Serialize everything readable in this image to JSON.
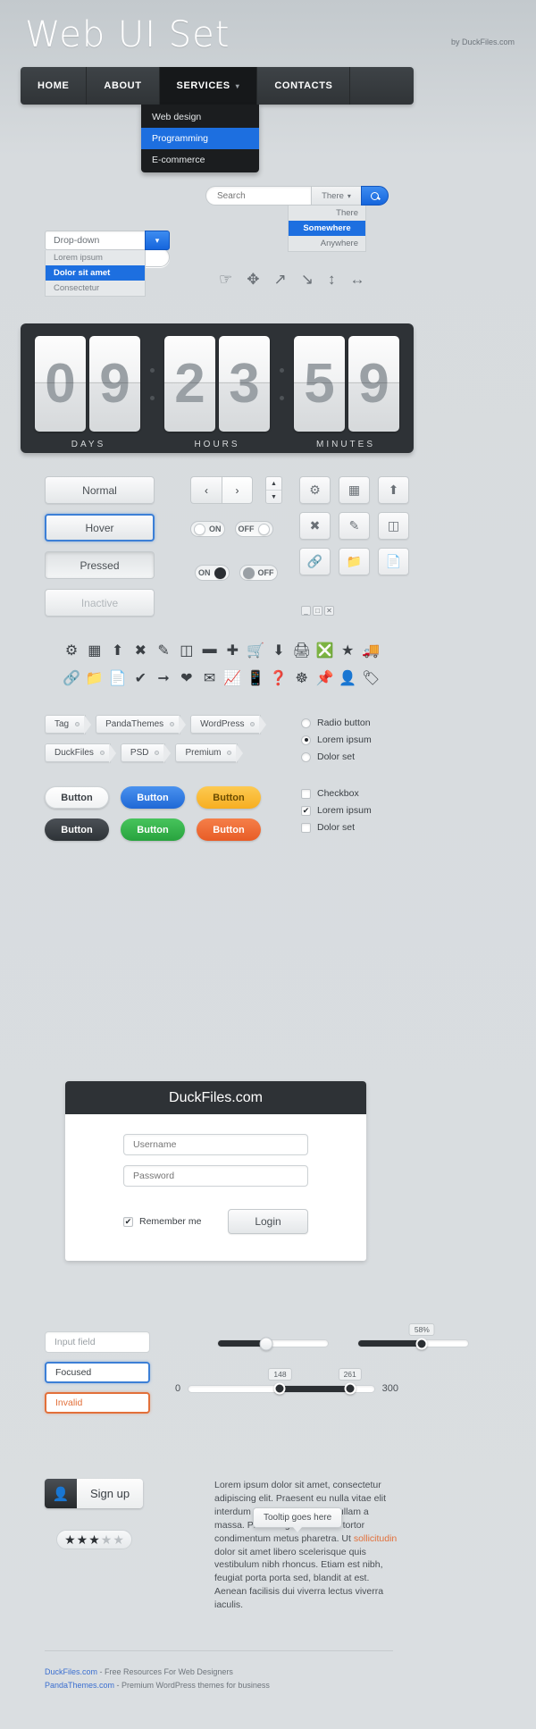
{
  "header": {
    "title": "Web UI Set",
    "byline": "by DuckFiles.com"
  },
  "nav": {
    "items": [
      {
        "label": "HOME",
        "active": false
      },
      {
        "label": "ABOUT",
        "active": false
      },
      {
        "label": "SERVICES",
        "active": true,
        "caret": "chevron-down"
      },
      {
        "label": "CONTACTS",
        "active": false
      }
    ],
    "submenu": [
      {
        "label": "Web design",
        "selected": false
      },
      {
        "label": "Programming",
        "selected": true
      },
      {
        "label": "E-commerce",
        "selected": false
      }
    ]
  },
  "search": {
    "rounded_placeholder": "Search",
    "combo_placeholder": "Search",
    "scope_value": "There",
    "scope_options": [
      {
        "label": "There",
        "selected": false
      },
      {
        "label": "Somewhere",
        "selected": true
      },
      {
        "label": "Anywhere",
        "selected": false
      }
    ]
  },
  "dropdown": {
    "value": "Drop-down",
    "options": [
      {
        "label": "Lorem ipsum",
        "selected": false
      },
      {
        "label": "Dolor sit amet",
        "selected": true
      },
      {
        "label": "Consectetur",
        "selected": false
      }
    ]
  },
  "cursors": [
    "pointer-hand-icon",
    "move-icon",
    "resize-nesw-icon",
    "resize-nwse-icon",
    "resize-ns-icon",
    "resize-ew-icon"
  ],
  "clock": {
    "days": [
      "0",
      "9"
    ],
    "hours": [
      "2",
      "3"
    ],
    "minutes": [
      "5",
      "9"
    ],
    "labels": [
      "DAYS",
      "HOURS",
      "MINUTES"
    ]
  },
  "button_states": [
    {
      "label": "Normal",
      "state": "normal"
    },
    {
      "label": "Hover",
      "state": "hover"
    },
    {
      "label": "Pressed",
      "state": "pressed"
    },
    {
      "label": "Inactive",
      "state": "inactive"
    }
  ],
  "stepper": {
    "prev": "‹",
    "next": "›",
    "up": "▲",
    "down": "▼"
  },
  "square_buttons": [
    [
      "gear-icon",
      "browser-window-icon",
      "upload-icon"
    ],
    [
      "close-x-icon",
      "pencil-icon",
      "box-icon"
    ],
    [
      "link-icon",
      "folder-icon",
      "file-icon"
    ]
  ],
  "toggles": {
    "pill_on_label": "ON",
    "pill_off_label": "OFF",
    "round_on_label": "ON",
    "round_off_label": "OFF"
  },
  "window_controls": [
    "minimize-icon",
    "maximize-icon",
    "close-icon"
  ],
  "icon_grid": {
    "row1": [
      "gear-icon",
      "browser-window-icon",
      "upload-icon",
      "close-x-icon",
      "pencil-icon",
      "box-icon",
      "minus-icon",
      "plus-icon",
      "cart-icon",
      "download-icon",
      "printer-icon",
      "cancel-circle-icon",
      "star-icon",
      "truck-icon"
    ],
    "row2": [
      "link-icon",
      "folder-icon",
      "file-icon",
      "check-icon",
      "arrow-right-icon",
      "heart-icon",
      "mail-icon",
      "bar-chart-icon",
      "mobile-icon",
      "help-circle-icon",
      "lifebuoy-icon",
      "pushpin-icon",
      "user-icon",
      "tag-icon"
    ]
  },
  "tags": {
    "row1": [
      "Tag",
      "PandaThemes",
      "WordPress"
    ],
    "row2": [
      "DuckFiles",
      "PSD",
      "Premium"
    ]
  },
  "radios": [
    {
      "label": "Radio button",
      "checked": false
    },
    {
      "label": "Lorem ipsum",
      "checked": true
    },
    {
      "label": "Dolor set",
      "checked": false
    }
  ],
  "checkboxes": [
    {
      "label": "Checkbox",
      "checked": false
    },
    {
      "label": "Lorem ipsum",
      "checked": true
    },
    {
      "label": "Dolor set",
      "checked": false
    }
  ],
  "colored_buttons": {
    "row1": [
      {
        "label": "Button",
        "color": "#ffffff",
        "text": "#3b4045"
      },
      {
        "label": "Button",
        "color": "#2f7bdb",
        "text": "#ffffff"
      },
      {
        "label": "Button",
        "color": "#fbc03a",
        "text": "#6b4c00"
      }
    ],
    "row2": [
      {
        "label": "Button",
        "color": "#3d4247",
        "text": "#ffffff"
      },
      {
        "label": "Button",
        "color": "#35b44a",
        "text": "#ffffff"
      },
      {
        "label": "Button",
        "color": "#ef6c36",
        "text": "#ffffff"
      }
    ]
  },
  "login": {
    "title": "DuckFiles.com",
    "username_placeholder": "Username",
    "password_placeholder": "Password",
    "remember_label": "Remember me",
    "remember_checked": true,
    "submit_label": "Login"
  },
  "input_fields": [
    {
      "label": "Input field",
      "state": "normal"
    },
    {
      "label": "Focused",
      "state": "focused"
    },
    {
      "label": "Invalid",
      "state": "invalid"
    }
  ],
  "sliders": {
    "plain": {
      "percent": 44
    },
    "labeled": {
      "percent": 58,
      "bubble": "58%"
    },
    "range": {
      "min_label": "0",
      "max_label": "300",
      "low": 148,
      "high": 261,
      "low_bubble": "148",
      "high_bubble": "261"
    }
  },
  "signup": {
    "label": "Sign up",
    "icon": "user-icon"
  },
  "rating": {
    "filled": 3,
    "total": 5
  },
  "tooltip": {
    "text": "Tooltip goes here"
  },
  "lorem": {
    "part1": "Lorem ipsum dolor sit amet, consectetur adipiscing elit. Praesent eu nulla vitae elit interdum sagittis eget a leo. Nullam a massa. Proin feugiat risus nec tortor condimentum metus pharetra. Ut ",
    "highlight": "sollicitudin",
    "part2": " dolor sit amet libero scelerisque quis vestibulum nibh rhoncus. Etiam est nibh, feugiat porta porta sed, blandit at est. Aenean facilisis dui viverra lectus viverra iaculis."
  },
  "footer": {
    "line1_link": "DuckFiles.com",
    "line1_text": " - Free Resources For Web Designers",
    "line2_link": "PandaThemes.com",
    "line2_text": " - Premium WordPress themes for business"
  }
}
